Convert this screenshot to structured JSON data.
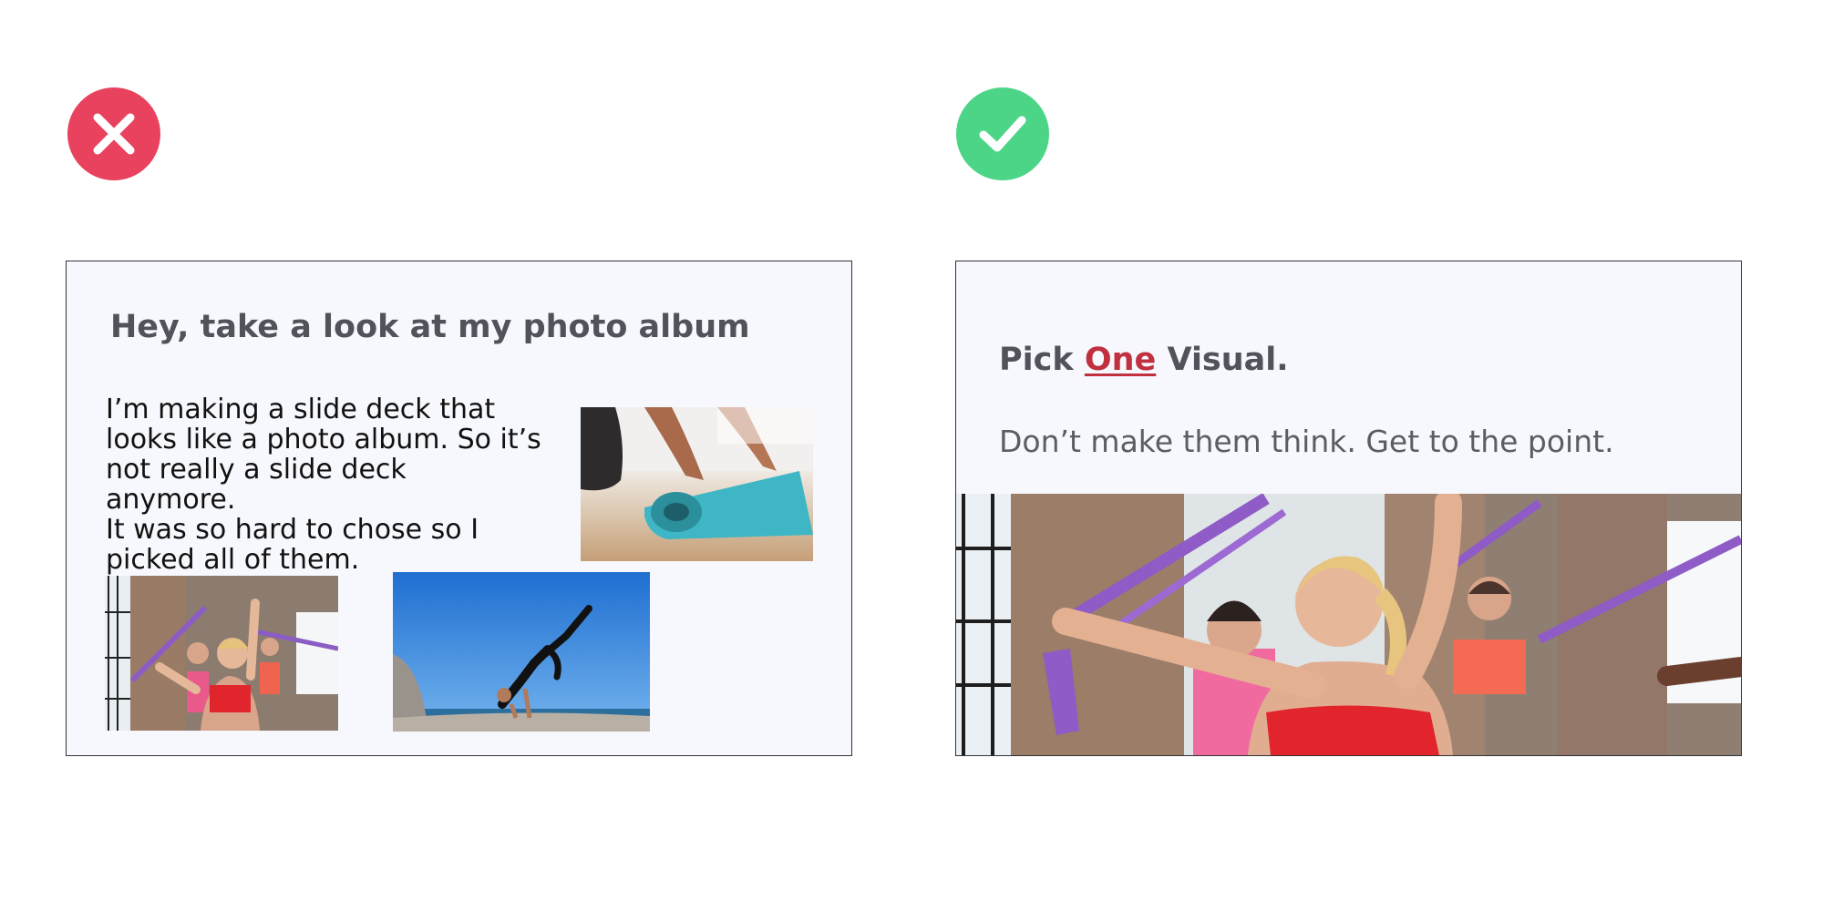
{
  "icons": {
    "bad": "close-x-icon",
    "good": "checkmark-icon"
  },
  "colors": {
    "bad_accent": "#e8425e",
    "good_accent": "#4dd587",
    "highlight": "#c0303f",
    "slide_background": "#f7f8fd",
    "title_text": "#50535a"
  },
  "bad_slide": {
    "title": "Hey, take a look at my photo album",
    "body_lines": [
      "I’m making a slide deck that",
      "looks like a photo album. So it’s",
      "not really a slide deck anymore.",
      "It was so hard to chose so I",
      "picked all of them."
    ],
    "photos": [
      "yoga-mat-photo",
      "fitness-class-photo",
      "yoga-pose-photo"
    ]
  },
  "good_slide": {
    "title_prefix": "Pick ",
    "title_highlight": "One",
    "title_suffix": " Visual.",
    "subtitle": "Don’t make them think. Get to the point.",
    "photo": "fitness-class-photo"
  }
}
